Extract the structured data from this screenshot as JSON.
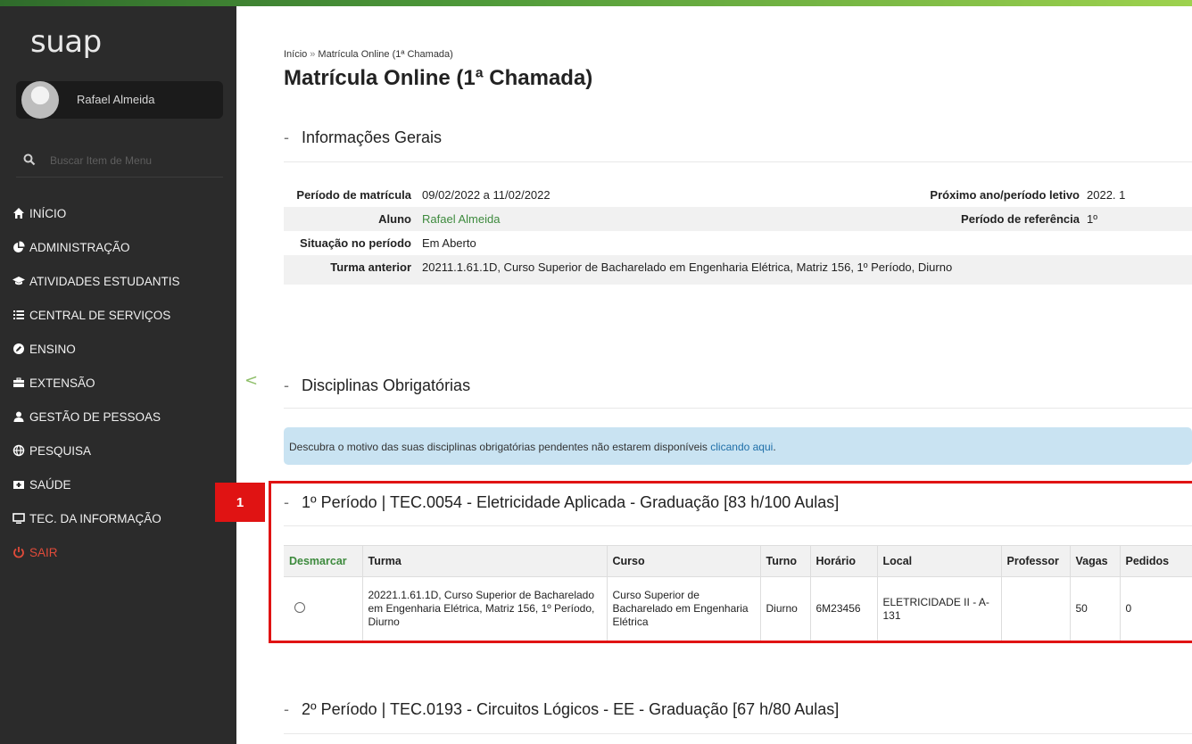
{
  "app": {
    "logo": "suap"
  },
  "user": {
    "name": "Rafael Almeida"
  },
  "sidebar": {
    "search_placeholder": "Buscar Item de Menu",
    "items": [
      {
        "label": "INÍCIO",
        "icon": "home-icon"
      },
      {
        "label": "ADMINISTRAÇÃO",
        "icon": "pie-chart-icon"
      },
      {
        "label": "ATIVIDADES ESTUDANTIS",
        "icon": "graduation-cap-icon"
      },
      {
        "label": "CENTRAL DE SERVIÇOS",
        "icon": "list-icon"
      },
      {
        "label": "ENSINO",
        "icon": "pencil-icon"
      },
      {
        "label": "EXTENSÃO",
        "icon": "briefcase-icon"
      },
      {
        "label": "GESTÃO DE PESSOAS",
        "icon": "user-icon"
      },
      {
        "label": "PESQUISA",
        "icon": "globe-icon"
      },
      {
        "label": "SAÚDE",
        "icon": "medical-kit-icon"
      },
      {
        "label": "TEC. DA INFORMAÇÃO",
        "icon": "monitor-icon"
      },
      {
        "label": "SAIR",
        "icon": "power-icon"
      }
    ],
    "collapse_glyph": "<"
  },
  "breadcrumb": {
    "home": "Início",
    "separator": "»",
    "current": "Matrícula Online (1ª Chamada)"
  },
  "page": {
    "title": "Matrícula Online (1ª Chamada)"
  },
  "info": {
    "heading": "Informações Gerais",
    "rows": [
      {
        "label": "Período de matrícula",
        "value": "09/02/2022 a 11/02/2022",
        "label2": "Próximo ano/período letivo",
        "value2": "2022. 1"
      },
      {
        "label": "Aluno",
        "value": "Rafael Almeida",
        "label2": "Período de referência",
        "value2": "1º"
      },
      {
        "label": "Situação no período",
        "value": "Em Aberto"
      },
      {
        "label": "Turma anterior",
        "value": "20211.1.61.1D, Curso Superior de Bacharelado em Engenharia Elétrica, Matriz 156, 1º Período, Diurno"
      }
    ]
  },
  "obrigatorias": {
    "heading": "Disciplinas Obrigatórias",
    "alert_text": "Descubra o motivo das suas disciplinas obrigatórias pendentes não estarem disponíveis ",
    "alert_link": "clicando aqui",
    "alert_end": "."
  },
  "callout": {
    "number": "1"
  },
  "disciplina1": {
    "heading": "1º Período | TEC.0054 - Eletricidade Aplicada - Graduação [83 h/100 Aulas]",
    "columns": [
      "Desmarcar",
      "Turma",
      "Curso",
      "Turno",
      "Horário",
      "Local",
      "Professor",
      "Vagas",
      "Pedidos"
    ],
    "row": {
      "turma": "20221.1.61.1D, Curso Superior de Bacharelado em Engenharia Elétrica, Matriz 156, 1º Período, Diurno",
      "curso": "Curso Superior de Bacharelado em Engenharia Elétrica",
      "turno": "Diurno",
      "horario": "6M23456",
      "local": "ELETRICIDADE II - A-131",
      "professor": "",
      "vagas": "50",
      "pedidos": "0"
    }
  },
  "disciplina2": {
    "heading": "2º Período | TEC.0193 - Circuitos Lógicos - EE - Graduação [67 h/80 Aulas]"
  },
  "colors": {
    "accent": "#3d8a3d",
    "sidebar": "#2b2b2b",
    "callout": "#e01313",
    "alert": "#c9e3f2",
    "sair": "#e04b3a"
  }
}
